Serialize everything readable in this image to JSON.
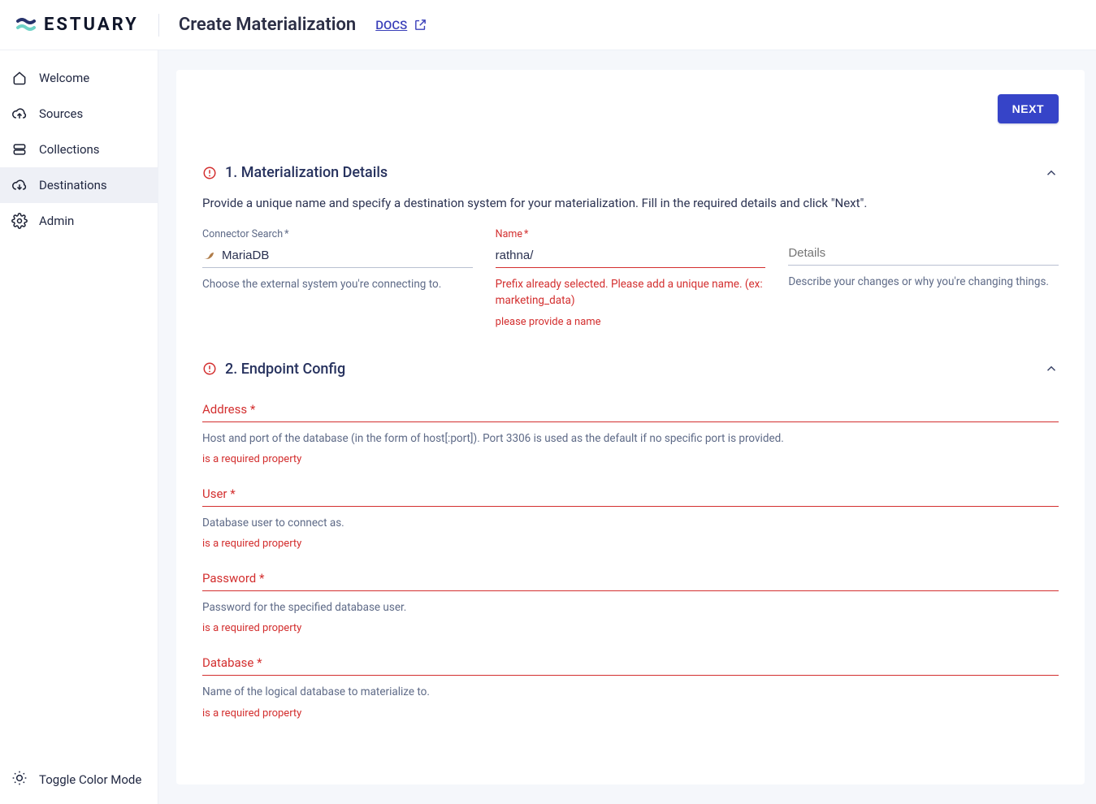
{
  "header": {
    "brand": "ESTUARY",
    "title": "Create Materialization",
    "docs_label": "DOCS"
  },
  "sidebar": {
    "items": [
      {
        "id": "welcome",
        "label": "Welcome"
      },
      {
        "id": "sources",
        "label": "Sources"
      },
      {
        "id": "collections",
        "label": "Collections"
      },
      {
        "id": "destinations",
        "label": "Destinations"
      },
      {
        "id": "admin",
        "label": "Admin"
      }
    ],
    "active": "destinations",
    "footer": {
      "color_mode": "Toggle Color Mode"
    }
  },
  "actions": {
    "next": "NEXT"
  },
  "section1": {
    "title": "1. Materialization Details",
    "description": "Provide a unique name and specify a destination system for your materialization. Fill in the required details and click \"Next\".",
    "connector": {
      "label": "Connector Search",
      "value": "MariaDB",
      "helper": "Choose the external system you're connecting to."
    },
    "name": {
      "label": "Name",
      "value": "rathna/",
      "helper": "Prefix already selected. Please add a unique name. (ex: marketing_data)",
      "error": "please provide a name"
    },
    "details": {
      "placeholder": "Details",
      "helper": "Describe your changes or why you're changing things."
    }
  },
  "section2": {
    "title": "2. Endpoint Config",
    "fields": [
      {
        "label": "Address",
        "helper": "Host and port of the database (in the form of host[:port]). Port 3306 is used as the default if no specific port is provided.",
        "error": "is a required property"
      },
      {
        "label": "User",
        "helper": "Database user to connect as.",
        "error": "is a required property"
      },
      {
        "label": "Password",
        "helper": "Password for the specified database user.",
        "error": "is a required property"
      },
      {
        "label": "Database",
        "helper": "Name of the logical database to materialize to.",
        "error": "is a required property"
      }
    ]
  }
}
